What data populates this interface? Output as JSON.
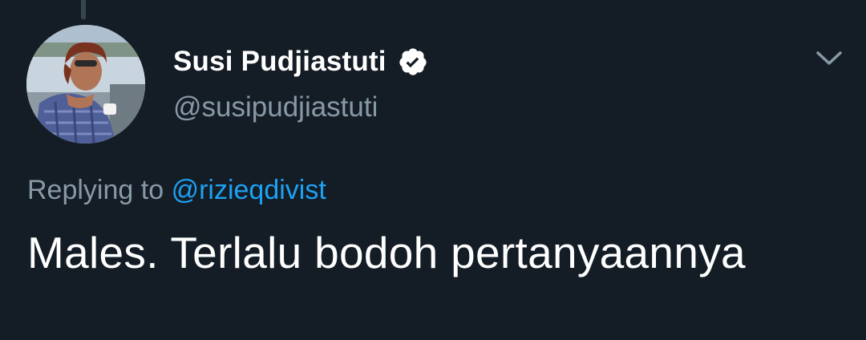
{
  "tweet": {
    "author": {
      "display_name": "Susi Pudjiastuti",
      "handle": "@susipudjiastuti",
      "verified": true,
      "avatar_icon": "user-avatar-photo"
    },
    "reply": {
      "prefix": "Replying to",
      "target": "@rizieqdivist"
    },
    "text": "Males. Terlalu bodoh pertanyaannya"
  },
  "icons": {
    "verified": "verified-badge-icon",
    "menu": "chevron-down-icon"
  },
  "colors": {
    "background": "#141d26",
    "primary_text": "#ffffff",
    "secondary_text": "#8899a6",
    "link": "#1da1f2"
  }
}
